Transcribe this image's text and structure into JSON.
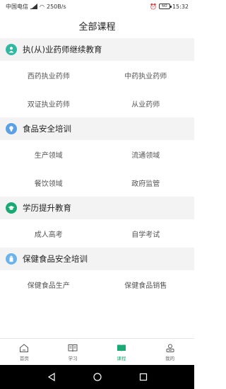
{
  "status_bar": {
    "carrier": "中国电信",
    "speed": "250B/s",
    "battery": "60",
    "time": "15:32"
  },
  "title": "全部课程",
  "colors": {
    "accent": "#1aa974",
    "section_icon_teal": "#32b7a0",
    "section_icon_blue": "#5aa0e6",
    "section_icon_green": "#1aa974",
    "section_icon_lightblue": "#6bb3ea"
  },
  "sections": [
    {
      "title": "执(从)业药师继续教育",
      "icon": "doctor-icon",
      "items": [
        "西药执业药师",
        "中药执业药师",
        "双证执业药师",
        "从业药师"
      ]
    },
    {
      "title": "食品安全培训",
      "icon": "bulb-icon",
      "items": [
        "生产领域",
        "流通领域",
        "餐饮领域",
        "政府监管"
      ]
    },
    {
      "title": "学历提升教育",
      "icon": "graduation-cap-icon",
      "items": [
        "成人高考",
        "自学考试"
      ]
    },
    {
      "title": "保健食品安全培训",
      "icon": "bottle-icon",
      "items": [
        "保健食品生产",
        "保健食品销售"
      ]
    }
  ],
  "tabs": [
    {
      "label": "首页",
      "icon": "home-icon",
      "active": false
    },
    {
      "label": "学习",
      "icon": "book-open-icon",
      "active": false
    },
    {
      "label": "课程",
      "icon": "course-icon",
      "active": true
    },
    {
      "label": "我的",
      "icon": "person-icon",
      "active": false
    }
  ]
}
